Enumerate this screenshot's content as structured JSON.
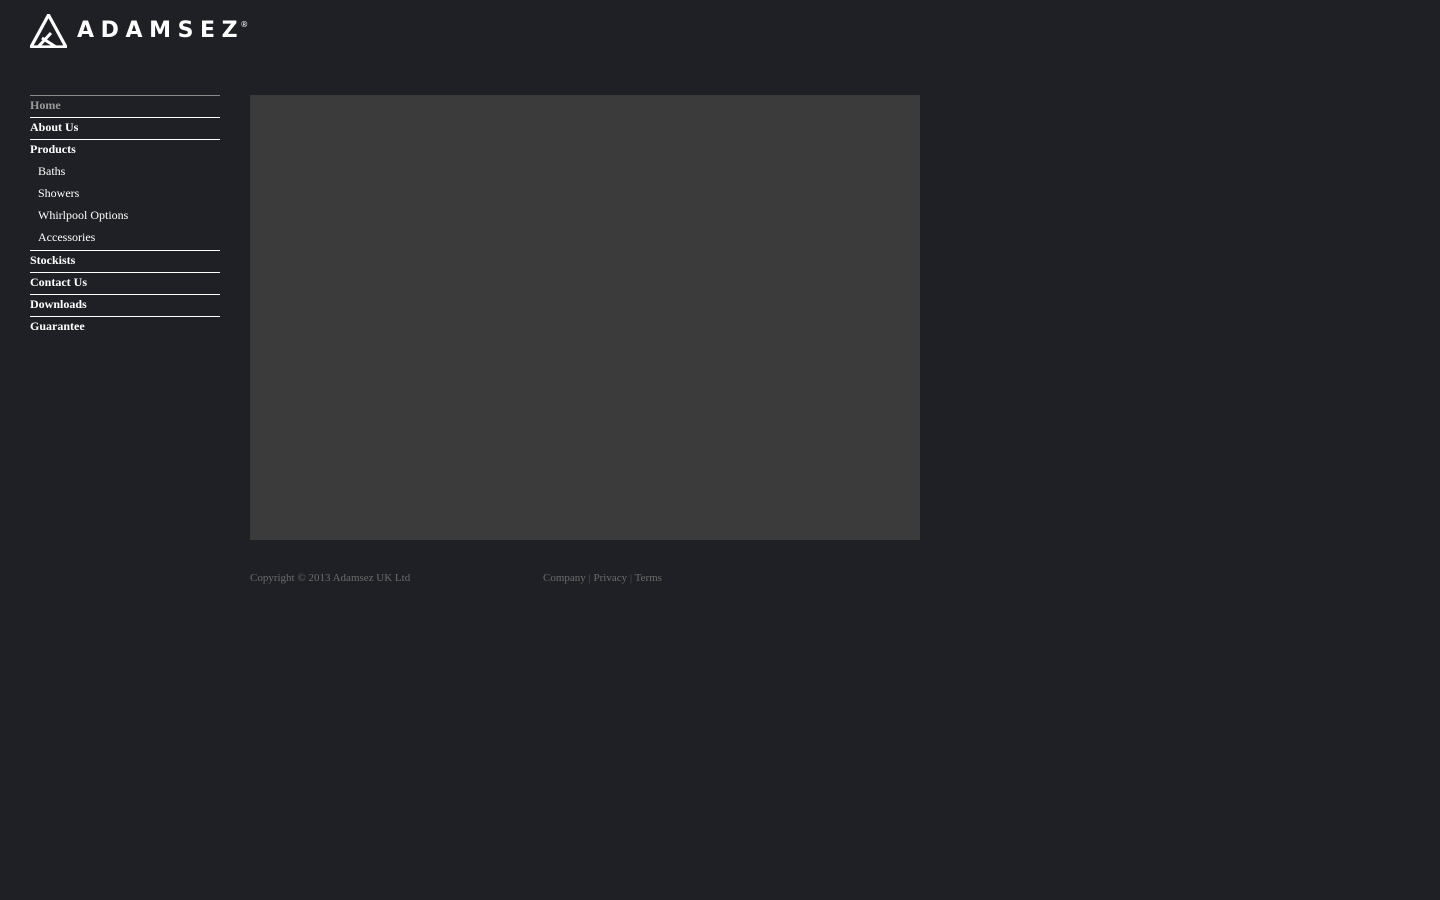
{
  "brand": {
    "name": "ADAMSEZ",
    "registered_mark": "®"
  },
  "nav": {
    "items": [
      {
        "label": "Home",
        "active": true
      },
      {
        "label": "About Us"
      },
      {
        "label": "Products",
        "children": [
          {
            "label": "Baths"
          },
          {
            "label": "Showers"
          },
          {
            "label": "Whirlpool Options"
          },
          {
            "label": "Accessories"
          }
        ]
      },
      {
        "label": "Stockists"
      },
      {
        "label": "Contact Us"
      },
      {
        "label": "Downloads"
      },
      {
        "label": "Guarantee"
      }
    ]
  },
  "footer": {
    "copyright": "Copyright © 2013 Adamsez UK Ltd",
    "links": [
      {
        "label": "Company"
      },
      {
        "label": "Privacy"
      },
      {
        "label": "Terms"
      }
    ],
    "separator": "|"
  },
  "colors": {
    "page_background": "#1f2025",
    "hero_background": "#3b3b3b",
    "nav_text": "#ffffff",
    "nav_active_text": "#9a9a9a",
    "footer_text": "#6c6c6c"
  },
  "icons": {
    "logo": "adamsez-triangle-logo-icon"
  }
}
